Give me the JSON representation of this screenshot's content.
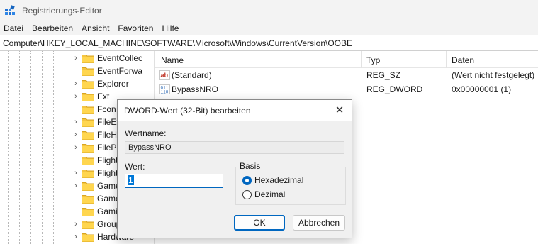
{
  "window": {
    "title": "Registrierungs-Editor"
  },
  "menu": [
    {
      "label": "Datei"
    },
    {
      "label": "Bearbeiten"
    },
    {
      "label": "Ansicht"
    },
    {
      "label": "Favoriten"
    },
    {
      "label": "Hilfe"
    }
  ],
  "address": "Computer\\HKEY_LOCAL_MACHINE\\SOFTWARE\\Microsoft\\Windows\\CurrentVersion\\OOBE",
  "tree": {
    "items": [
      {
        "label": "EventCollec",
        "expandable": true
      },
      {
        "label": "EventForwa",
        "expandable": false
      },
      {
        "label": "Explorer",
        "expandable": true
      },
      {
        "label": "Ext",
        "expandable": true
      },
      {
        "label": "Fcon",
        "expandable": false
      },
      {
        "label": "FileExp",
        "expandable": true
      },
      {
        "label": "FileHis",
        "expandable": true
      },
      {
        "label": "FilePic",
        "expandable": true
      },
      {
        "label": "Flight",
        "expandable": false
      },
      {
        "label": "Flight",
        "expandable": true
      },
      {
        "label": "Game",
        "expandable": true
      },
      {
        "label": "Game",
        "expandable": false
      },
      {
        "label": "Gamin",
        "expandable": false
      },
      {
        "label": "Group",
        "expandable": true
      },
      {
        "label": "Hardware",
        "expandable": true
      }
    ]
  },
  "list": {
    "columns": {
      "name": "Name",
      "type": "Typ",
      "data": "Daten"
    },
    "rows": [
      {
        "name": "(Standard)",
        "type": "REG_SZ",
        "data": "(Wert nicht festgelegt)",
        "icon": "string-value-icon"
      },
      {
        "name": "BypassNRO",
        "type": "REG_DWORD",
        "data": "0x00000001 (1)",
        "icon": "binary-value-icon"
      }
    ]
  },
  "dialog": {
    "title": "DWORD-Wert (32-Bit) bearbeiten",
    "close_glyph": "✕",
    "name_label": "Wertname:",
    "name_value": "BypassNRO",
    "value_label": "Wert:",
    "value_data": "1",
    "base_label": "Basis",
    "radio_hex": "Hexadezimal",
    "radio_dec": "Dezimal",
    "selected_base": "hex",
    "ok_label": "OK",
    "cancel_label": "Abbrechen",
    "accent_color": "#0067c0"
  }
}
